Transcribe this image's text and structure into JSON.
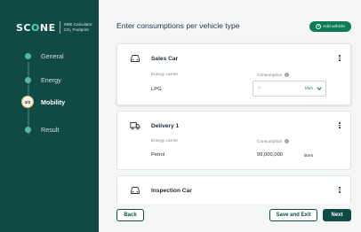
{
  "app": {
    "logo_main": "SC",
    "logo_accent": "O",
    "logo_rest": "NE",
    "subtitle_line1": "SME Calculator",
    "subtitle_line2": "CO₂ Footprint"
  },
  "steps": [
    {
      "label": "General",
      "state": "done"
    },
    {
      "label": "Energy",
      "state": "done"
    },
    {
      "label": "Mobility",
      "state": "active",
      "badge": "2/3"
    },
    {
      "label": "Result",
      "state": "todo"
    }
  ],
  "page": {
    "title": "Enter consumptions per vehicle type",
    "add_button": "Add vehicle"
  },
  "vehicles": [
    {
      "name": "Sales Car",
      "icon": "car-icon",
      "carrier_header": "Energy carrier",
      "consumption_header": "Consumption",
      "carrier": "LPG",
      "consumption_placeholder": "0",
      "unit": "l/km"
    },
    {
      "name": "Delivery 1",
      "icon": "truck-icon",
      "carrier_header": "Energy carrier",
      "consumption_header": "Consumption",
      "carrier": "Petrol",
      "consumption": "99,000,000",
      "unit": "liters"
    },
    {
      "name": "Inspection Car",
      "icon": "car-icon"
    }
  ],
  "footer": {
    "back": "Back",
    "save_exit": "Save and Exit",
    "next": "Next"
  },
  "colors": {
    "sidebar": "#0f4a45",
    "accent": "#0e7a58",
    "brand_accent": "#41d6b0"
  }
}
